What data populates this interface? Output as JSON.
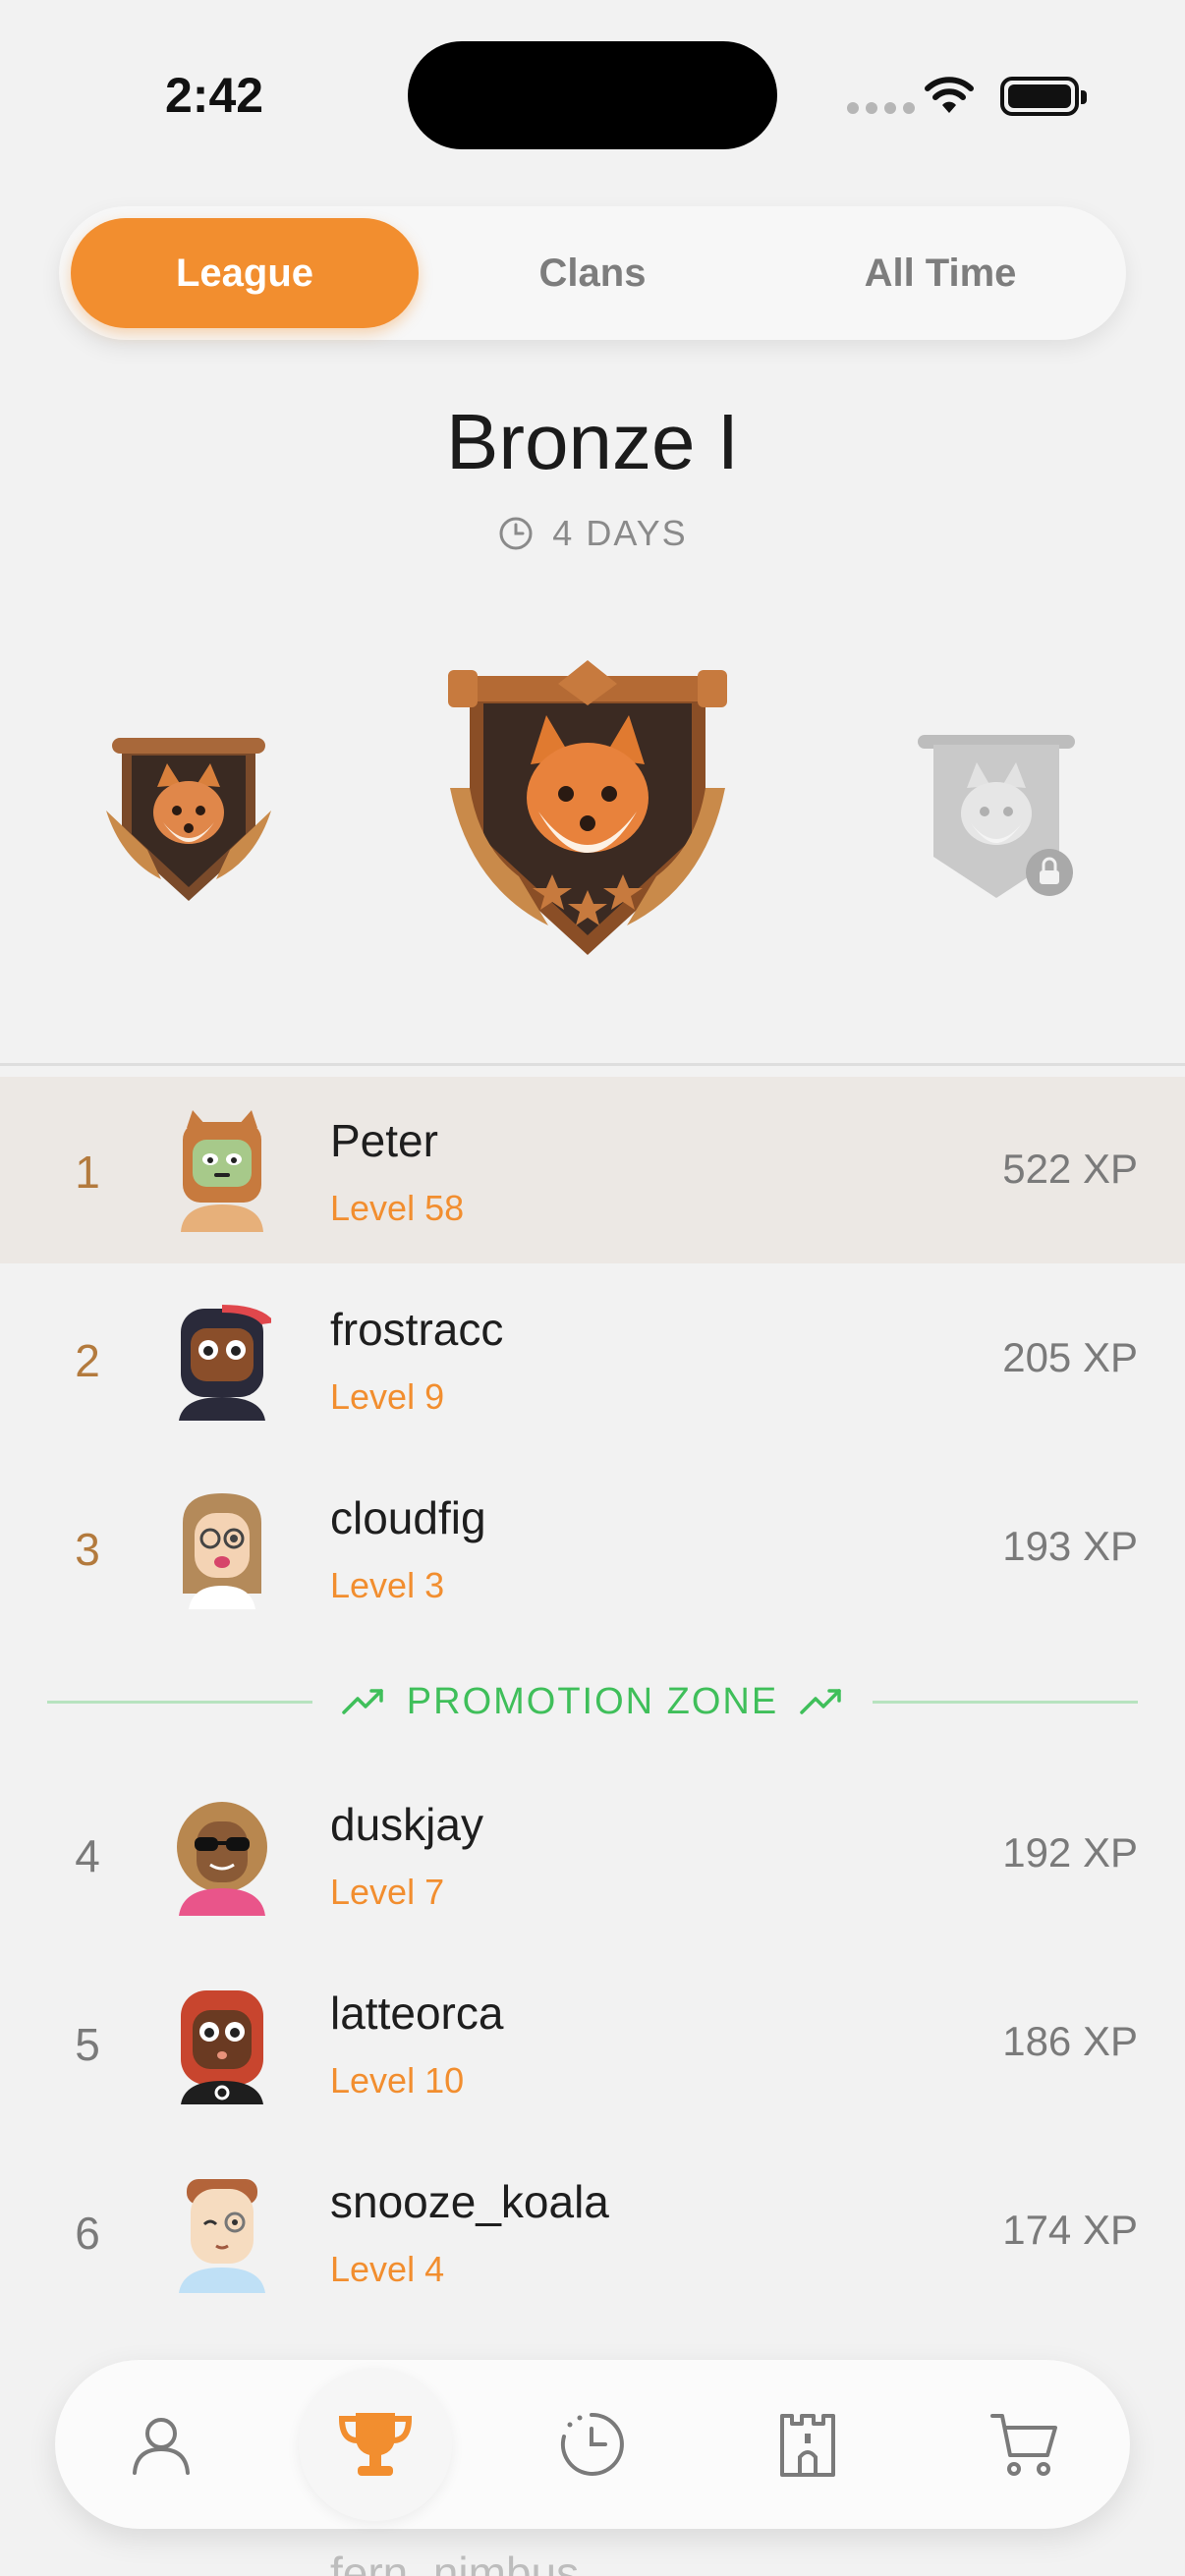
{
  "status_bar": {
    "time": "2:42"
  },
  "tabs": [
    {
      "label": "League",
      "active": true
    },
    {
      "label": "Clans",
      "active": false
    },
    {
      "label": "All Time",
      "active": false
    }
  ],
  "league": {
    "title": "Bronze I",
    "countdown": "4 DAYS"
  },
  "badges": {
    "left": "fox-badge-small",
    "center": "fox-badge-bronze",
    "right": "fox-badge-locked"
  },
  "promotion_zone_label": "PROMOTION ZONE",
  "leaderboard": [
    {
      "rank": "1",
      "name": "Peter",
      "level": "Level 58",
      "xp": "522 XP"
    },
    {
      "rank": "2",
      "name": "frostracc",
      "level": "Level 9",
      "xp": "205 XP"
    },
    {
      "rank": "3",
      "name": "cloudfig",
      "level": "Level 3",
      "xp": "193 XP"
    },
    {
      "rank": "4",
      "name": "duskjay",
      "level": "Level 7",
      "xp": "192 XP"
    },
    {
      "rank": "5",
      "name": "latteorca",
      "level": "Level 10",
      "xp": "186 XP"
    },
    {
      "rank": "6",
      "name": "snooze_koala",
      "level": "Level 4",
      "xp": "174 XP"
    }
  ],
  "partial_next_name": "fern_nimbus",
  "bottom_nav": [
    {
      "icon": "profile-icon",
      "active": false
    },
    {
      "icon": "trophy-icon",
      "active": true
    },
    {
      "icon": "history-icon",
      "active": false
    },
    {
      "icon": "castle-icon",
      "active": false
    },
    {
      "icon": "cart-icon",
      "active": false
    }
  ],
  "colors": {
    "accent": "#f28e2f",
    "promotion": "#3fbf5a",
    "background": "#f2f2f2",
    "highlight_row": "#ece8e4",
    "rank_top": "#b37a3d"
  }
}
